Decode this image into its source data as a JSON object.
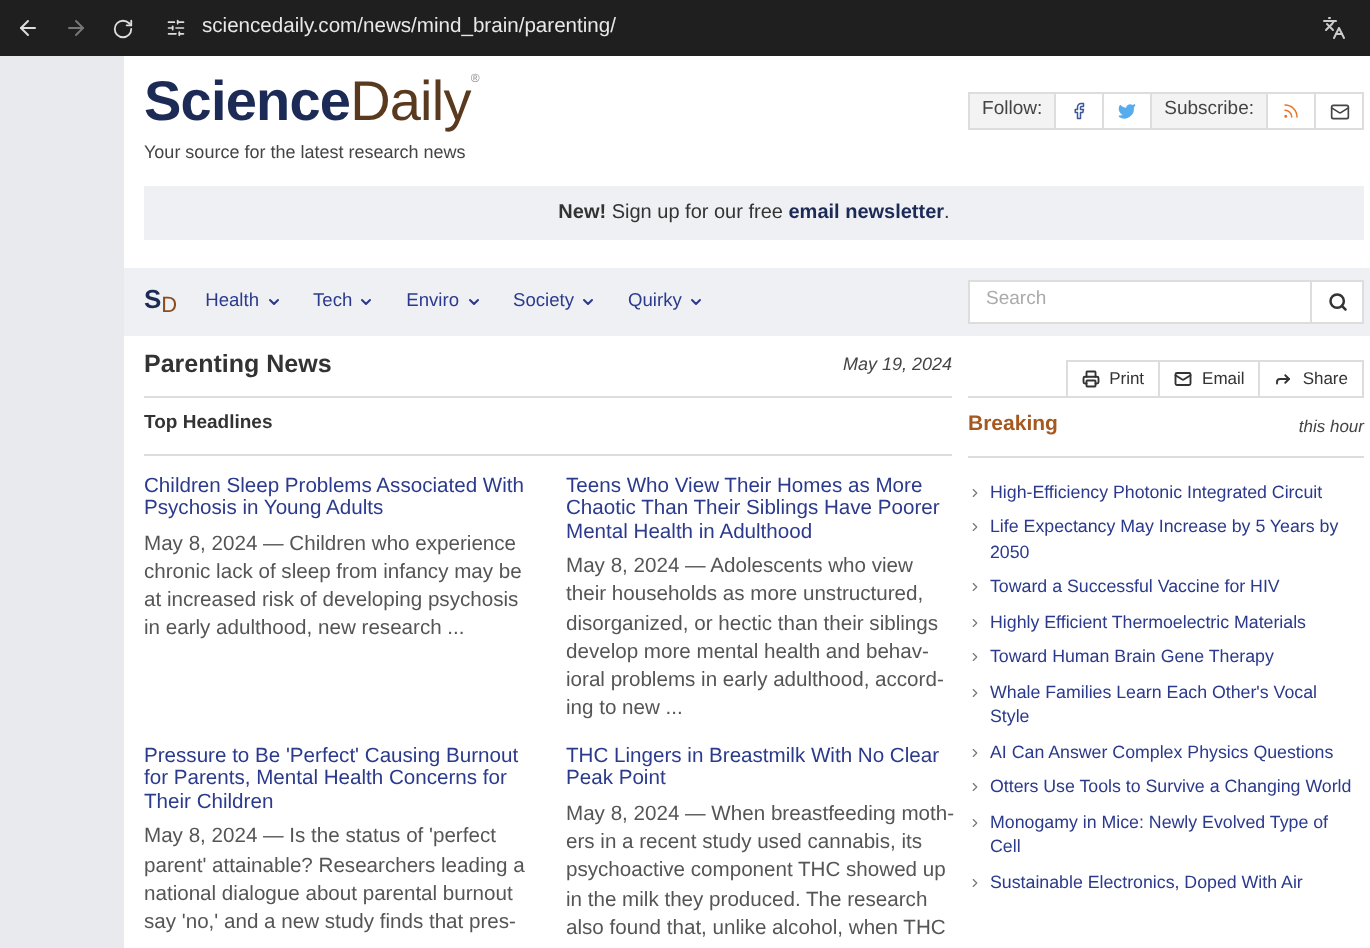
{
  "browser": {
    "url": "sciencedaily.com/news/mind_brain/parenting/"
  },
  "header": {
    "logo_main": "Science",
    "logo_accent": "Daily",
    "logo_mark": "®",
    "tagline": "Your source for the latest research news",
    "follow_label": "Follow:",
    "subscribe_label": "Subscribe:"
  },
  "newsletter": {
    "text": "**New!** Sign up for our free ",
    "link": "email newsletter",
    "end": "."
  },
  "nav": {
    "logo_s": "S",
    "logo_d": "D",
    "items": [
      {
        "label": "Health"
      },
      {
        "label": "Tech"
      },
      {
        "label": "Enviro"
      },
      {
        "label": "Society"
      },
      {
        "label": "Quirky"
      }
    ],
    "search": {
      "placeholder": "Search"
    }
  },
  "main": {
    "title": "Parenting News",
    "date": "May 19, 2024",
    "section": "Top Headlines",
    "articles": [
      {
        "headline": "Children Sleep Problems Associated With Psychosis in Young Adults",
        "lines": [
          "May 8, 2024 — Children who experience",
          "chronic lack of sleep from infancy may be",
          "at increased risk of developing psychosis",
          "in early adulthood, new research ..."
        ]
      },
      {
        "headline": "Teens Who View Their Homes as More Chaotic Than Their Siblings Have Poorer Mental Health in Adulthood",
        "lines": [
          "May 8, 2024 — Adolescents who view",
          "their households as more unstructured,",
          "disorganized, or hectic than their siblings",
          "develop more mental health and behav-",
          "ioral problems in early adulthood, accord-",
          "ing to new ..."
        ]
      },
      {
        "headline": "Pressure to Be 'Perfect' Causing Burnout for Parents, Mental Health Concerns for Their Children",
        "lines": [
          "May 8, 2024 — Is the status of 'perfect",
          "parent' attainable? Researchers leading a",
          "national dialogue about parental burnout",
          "say 'no,' and a new study finds that pres-"
        ]
      },
      {
        "headline": "THC Lingers in Breastmilk With No Clear Peak Point",
        "lines": [
          "May 8, 2024 — When breastfeeding moth-",
          "ers in a recent study used cannabis, its",
          "psychoactive component THC showed up",
          "in the milk they produced. The research",
          "also found that, unlike alcohol, when THC"
        ]
      }
    ]
  },
  "sidebar": {
    "actions": [
      {
        "kind": "print",
        "label": "Print"
      },
      {
        "kind": "email",
        "label": "Email"
      },
      {
        "kind": "share",
        "label": "Share"
      }
    ],
    "breaking_title": "Breaking",
    "breaking_when": "this hour",
    "items": [
      "High-Efficiency Photonic Integrated Circuit",
      "Life Expectancy May Increase by 5 Years by 2050",
      "Toward a Successful Vaccine for HIV",
      "Highly Efficient Thermoelectric Materials",
      "Toward Human Brain Gene Therapy",
      "Whale Families Learn Each Other's Vocal Style",
      "AI Can Answer Complex Physics Questions",
      "Otters Use Tools to Survive a Changing World",
      "Monogamy in Mice: Newly Evolved Type of Cell",
      "Sustainable Electronics, Doped With Air"
    ]
  }
}
